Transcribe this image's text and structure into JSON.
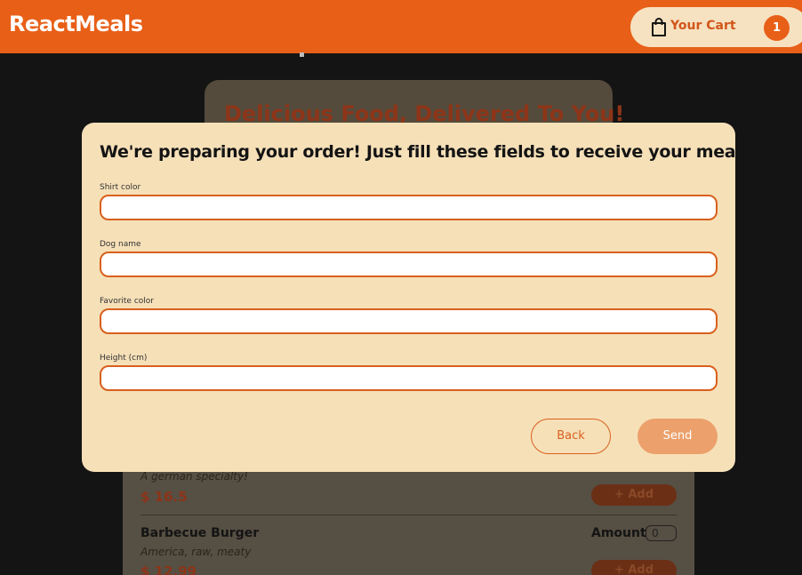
{
  "header": {
    "brand": "ReactMeals",
    "cart_label": "Your Cart",
    "cart_count": "1"
  },
  "summary": {
    "title": "Delicious Food, Delivered To You!"
  },
  "meals": [
    {
      "name": "",
      "description": "A german specialty!",
      "price": "$ 16.5",
      "amount_label": "",
      "amount": "",
      "add_label": "+ Add"
    },
    {
      "name": "Barbecue Burger",
      "description": "America, raw, meaty",
      "price": "$ 12.99",
      "amount_label": "Amount",
      "amount": "0",
      "add_label": "+ Add"
    }
  ],
  "modal": {
    "title": "We're preparing your order! Just fill these fields to receive your meals",
    "fields": [
      {
        "label": "Shirt color",
        "value": ""
      },
      {
        "label": "Dog name",
        "value": ""
      },
      {
        "label": "Favorite color",
        "value": ""
      },
      {
        "label": "Height (cm)",
        "value": ""
      }
    ],
    "back_label": "Back",
    "send_label": "Send"
  },
  "colors": {
    "accent": "#e85f17",
    "modal_bg": "#f6e0b8",
    "input_border": "#d9601e",
    "send_button": "#eca06b"
  },
  "icons": {
    "cart": "shopping-bag-icon"
  }
}
